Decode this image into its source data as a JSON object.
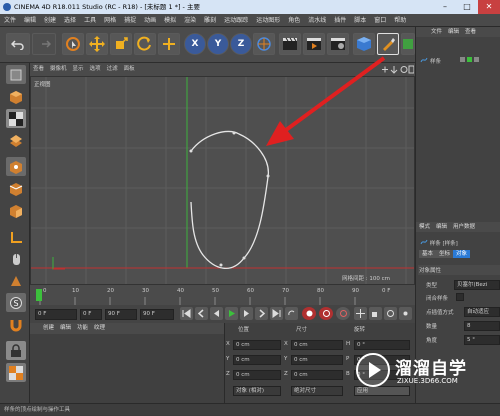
{
  "window": {
    "title": "CINEMA 4D R18.011 Studio (RC - R18) - [未标题 1 *] - 主要",
    "min": "–",
    "max": "□",
    "close": "✕"
  },
  "menu": [
    "文件",
    "编辑",
    "创建",
    "选择",
    "工具",
    "网格",
    "捕捉",
    "动画",
    "模拟",
    "渲染",
    "雕刻",
    "运动跟踪",
    "运动图形",
    "角色",
    "流水线",
    "插件",
    "脚本",
    "窗口",
    "帮助"
  ],
  "viewport": {
    "menu": [
      "查看",
      "摄像机",
      "显示",
      "选项",
      "过滤",
      "面板"
    ],
    "label": "正视图",
    "grid_info": "网格间距 : 100 cm"
  },
  "timeline": {
    "ticks": [
      "0",
      "10",
      "20",
      "30",
      "40",
      "50",
      "60",
      "70",
      "80",
      "90"
    ],
    "current": "0 F"
  },
  "transport": {
    "field1": "0 F",
    "field2": "0 F",
    "field3": "90 F",
    "field4": "90 F"
  },
  "material_menu": [
    "创建",
    "编辑",
    "功能",
    "纹理"
  ],
  "coords": {
    "headers": [
      "位置",
      "尺寸",
      "旋转"
    ],
    "rows": [
      {
        "axis": "X",
        "pos": "0 cm",
        "size_axis": "X",
        "size": "0 cm",
        "rot_axis": "H",
        "rot": "0 °"
      },
      {
        "axis": "Y",
        "pos": "0 cm",
        "size_axis": "Y",
        "size": "0 cm",
        "rot_axis": "P",
        "rot": "0 °"
      },
      {
        "axis": "Z",
        "pos": "0 cm",
        "size_axis": "Z",
        "size": "0 cm",
        "rot_axis": "B",
        "rot": "0 °"
      }
    ],
    "mode_select": "对象 (相对)",
    "size_select": "绝对尺寸",
    "apply": "应用"
  },
  "objects_panel": {
    "menu": [
      "文件",
      "编辑",
      "查看"
    ],
    "item": "样条"
  },
  "attributes": {
    "menu": [
      "模式",
      "编辑",
      "用户数据"
    ],
    "object_label": "样条 [样条]",
    "tabs": [
      "基本",
      "坐标",
      "对象"
    ],
    "section": "对象属性",
    "rows": [
      {
        "label": "类型",
        "value": "贝塞尔(Bezi"
      },
      {
        "label": "闭合样条",
        "value": ""
      },
      {
        "label": "点插值方式",
        "value": "自动适应"
      },
      {
        "label": "数量",
        "value": "8"
      },
      {
        "label": "角度",
        "value": "5 °"
      }
    ]
  },
  "status": "样条的顶点绘制与操作工具",
  "watermark": {
    "title": "溜溜自学",
    "url": "ZIXUE.3D66.COM"
  },
  "colors": {
    "accent": "#2a7ad6",
    "arrow": "#e02020",
    "viewport_bg": "#4f4f4f",
    "green_axis": "#3cb03c",
    "red_axis": "#c03030"
  }
}
